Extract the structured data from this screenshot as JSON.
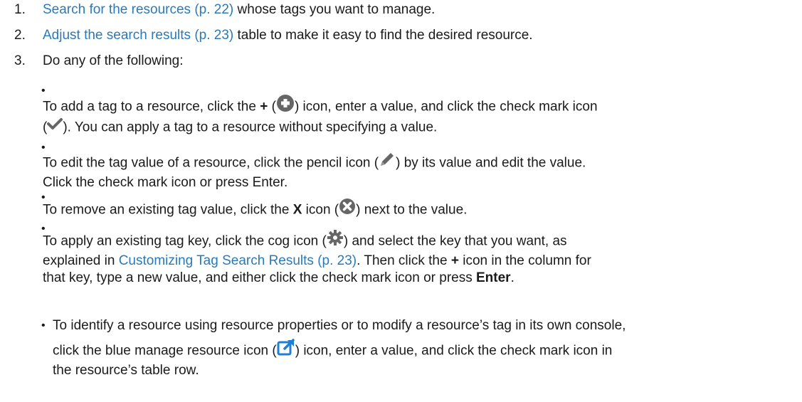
{
  "steps": [
    {
      "num": "1.",
      "link": "Search for the resources (p. 22)",
      "text": " whose tags you want to manage."
    },
    {
      "num": "2.",
      "link": "Adjust the search results (p. 23)",
      "text": " table to make it easy to find the desired resource."
    },
    {
      "num": "3.",
      "text": "Do any of the following:"
    }
  ],
  "bullets": {
    "b1": {
      "a": "To add a tag to a resource, click the ",
      "plus": "+",
      "b": " (",
      "c": ") icon, enter a value, and click the check mark icon",
      "d": "(",
      "e": "). You can apply a tag to a resource without specifying a value."
    },
    "b2": {
      "a": "To edit the tag value of a resource, click the pencil icon (",
      "b": ") by its value and edit the value.",
      "c": "Click the check mark icon or press Enter."
    },
    "b3": {
      "a": "To remove an existing tag value, click the ",
      "x": "X",
      "b": " icon (",
      "c": ") next to the value."
    },
    "b4": {
      "a": "To apply an existing tag key, click the cog icon (",
      "b": ") and select the key that you want, as",
      "c": "explained in ",
      "link": "Customizing Tag Search Results (p. 23)",
      "d": ". Then click the ",
      "plus": "+",
      "e": " icon in the column for",
      "f": "that key, type a new value, and either click the check mark icon or press ",
      "enter": "Enter",
      "g": "."
    },
    "b5": {
      "a": "To identify a resource using resource properties or to modify a resource’s tag in its own console,",
      "b": "click the blue manage resource icon (",
      "c": ") icon, enter a value, and click the check mark icon in",
      "d": "the resource’s table row."
    }
  },
  "bullet_symbol": "•",
  "colors": {
    "link": "#2a7ab8",
    "icon_gray": "#666666",
    "icon_blue": "#1f7fd1"
  }
}
